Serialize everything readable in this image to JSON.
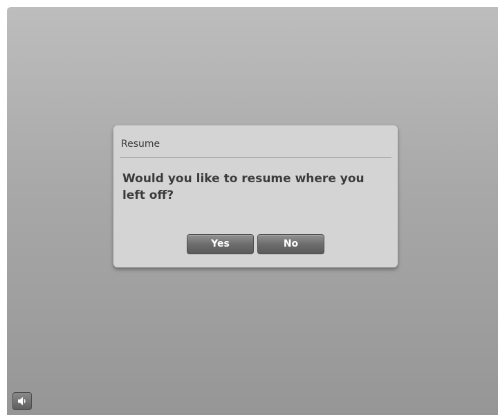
{
  "dialog": {
    "title": "Resume",
    "message": "Would you like to resume where you left off?",
    "yes_label": "Yes",
    "no_label": "No"
  },
  "controls": {
    "sound_icon": "speaker-icon"
  },
  "colors": {
    "background_top": "#bdbdbd",
    "background_bottom": "#969696",
    "dialog_bg": "#d4d4d4",
    "button_bg": "#6d6d6d",
    "text": "#3b3b3b"
  }
}
